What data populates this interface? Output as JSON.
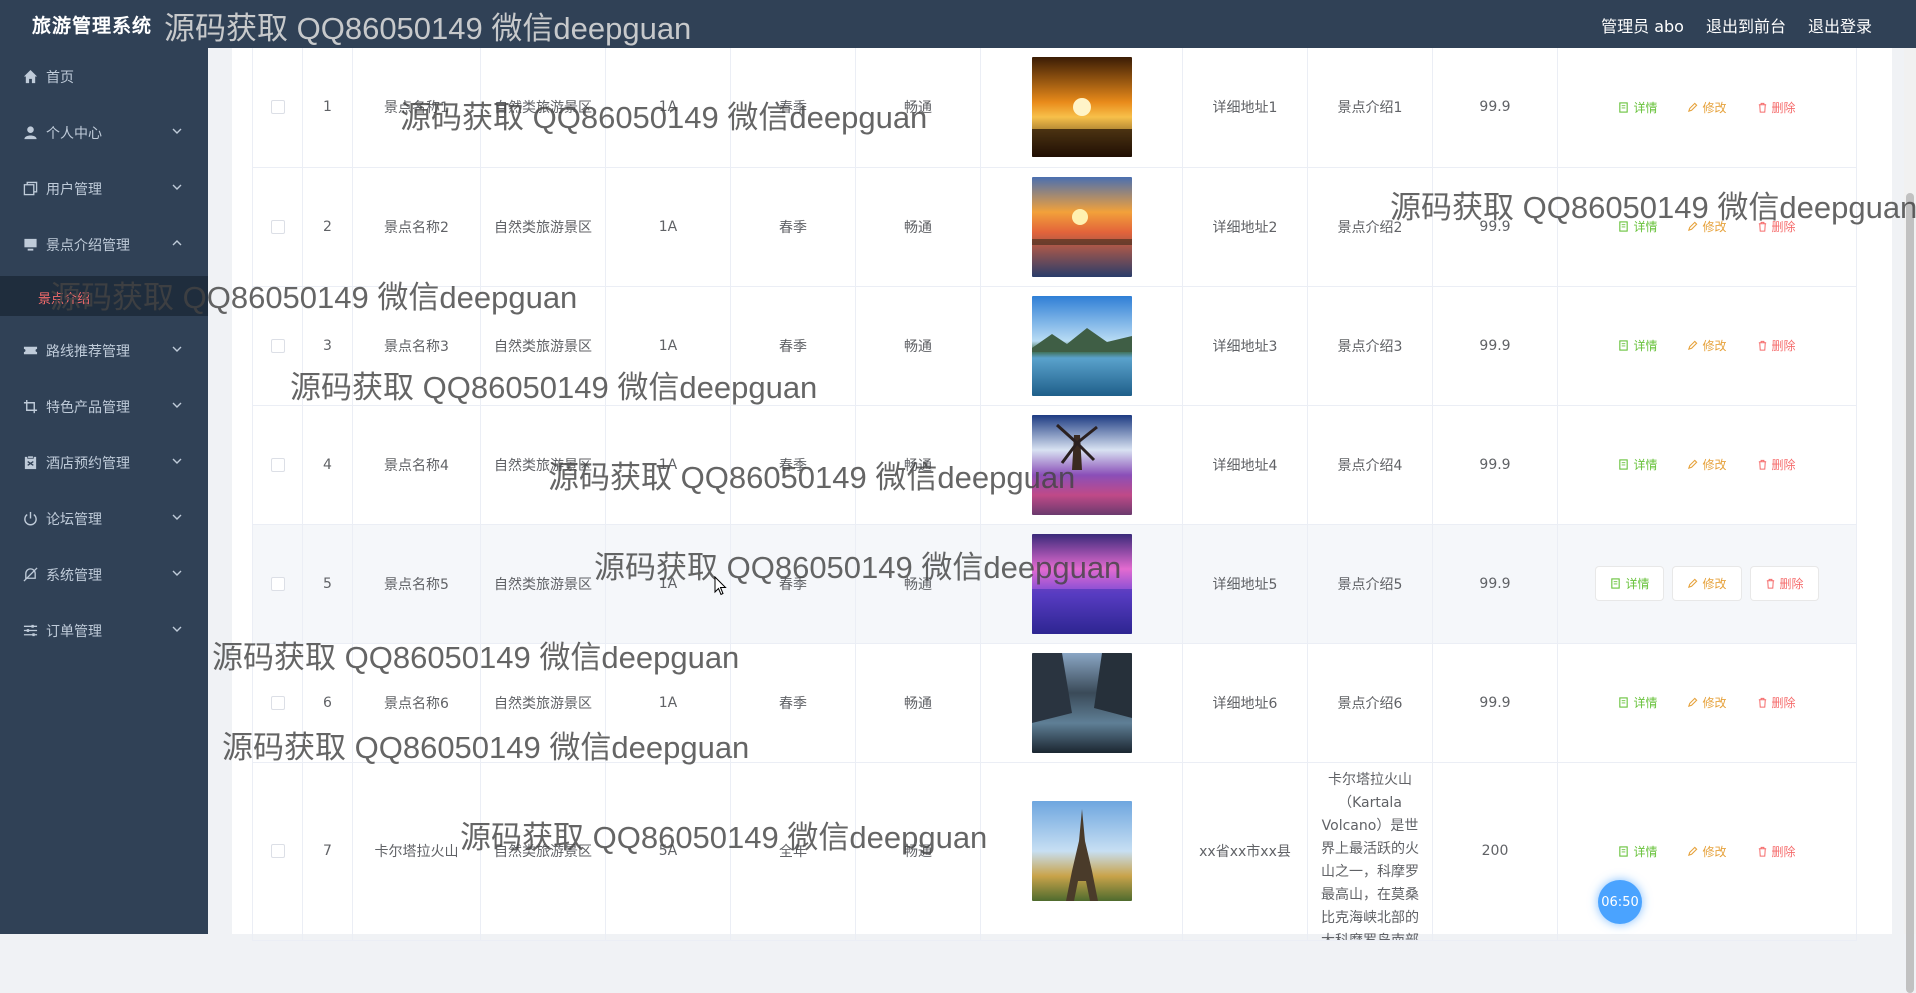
{
  "header": {
    "title": "旅游管理系统",
    "user": "管理员 abo",
    "to_front": "退出到前台",
    "logout": "退出登录"
  },
  "sidebar": {
    "items": [
      {
        "label": "首页",
        "icon": "home-icon"
      },
      {
        "label": "个人中心",
        "icon": "user-icon"
      },
      {
        "label": "用户管理",
        "icon": "copy-icon"
      },
      {
        "label": "景点介绍管理",
        "icon": "monitor-icon"
      },
      {
        "label": "路线推荐管理",
        "icon": "ticket-icon"
      },
      {
        "label": "特色产品管理",
        "icon": "crop-icon"
      },
      {
        "label": "酒店预约管理",
        "icon": "box-icon"
      },
      {
        "label": "论坛管理",
        "icon": "power-icon"
      },
      {
        "label": "系统管理",
        "icon": "bell-off-icon"
      },
      {
        "label": "订单管理",
        "icon": "sliders-icon"
      }
    ],
    "active_sub": "景点介绍"
  },
  "rows": [
    {
      "no": "1",
      "name": "景点名称1",
      "type": "自然类旅游景区",
      "level": "1A",
      "season": "春季",
      "traffic": "畅通",
      "address": "详细地址1",
      "intro": "景点介绍1",
      "price": "99.9"
    },
    {
      "no": "2",
      "name": "景点名称2",
      "type": "自然类旅游景区",
      "level": "1A",
      "season": "春季",
      "traffic": "畅通",
      "address": "详细地址2",
      "intro": "景点介绍2",
      "price": "99.9"
    },
    {
      "no": "3",
      "name": "景点名称3",
      "type": "自然类旅游景区",
      "level": "1A",
      "season": "春季",
      "traffic": "畅通",
      "address": "详细地址3",
      "intro": "景点介绍3",
      "price": "99.9"
    },
    {
      "no": "4",
      "name": "景点名称4",
      "type": "自然类旅游景区",
      "level": "1A",
      "season": "春季",
      "traffic": "畅通",
      "address": "详细地址4",
      "intro": "景点介绍4",
      "price": "99.9"
    },
    {
      "no": "5",
      "name": "景点名称5",
      "type": "自然类旅游景区",
      "level": "1A",
      "season": "春季",
      "traffic": "畅通",
      "address": "详细地址5",
      "intro": "景点介绍5",
      "price": "99.9"
    },
    {
      "no": "6",
      "name": "景点名称6",
      "type": "自然类旅游景区",
      "level": "1A",
      "season": "春季",
      "traffic": "畅通",
      "address": "详细地址6",
      "intro": "景点介绍6",
      "price": "99.9"
    },
    {
      "no": "7",
      "name": "卡尔塔拉火山",
      "type": "自然类旅游景区",
      "level": "5A",
      "season": "全年",
      "traffic": "畅通",
      "address": "xx省xx市xx县",
      "intro": "卡尔塔拉火山（Kartala Volcano）是世界上最活跃的火山之一，科摩罗最高山，在莫桑比克海峡北部的大科摩罗岛南部",
      "price": "200"
    }
  ],
  "actions": {
    "detail": "详情",
    "edit": "修改",
    "delete": "删除"
  },
  "watermark": "源码获取 QQ86050149 微信deepguan",
  "timer": "06:50",
  "colors": {
    "sidebar": "#304156",
    "detail": "#67c23a",
    "edit": "#e6a23c",
    "delete": "#f56c6c",
    "active_sub": "#f56c6c"
  }
}
